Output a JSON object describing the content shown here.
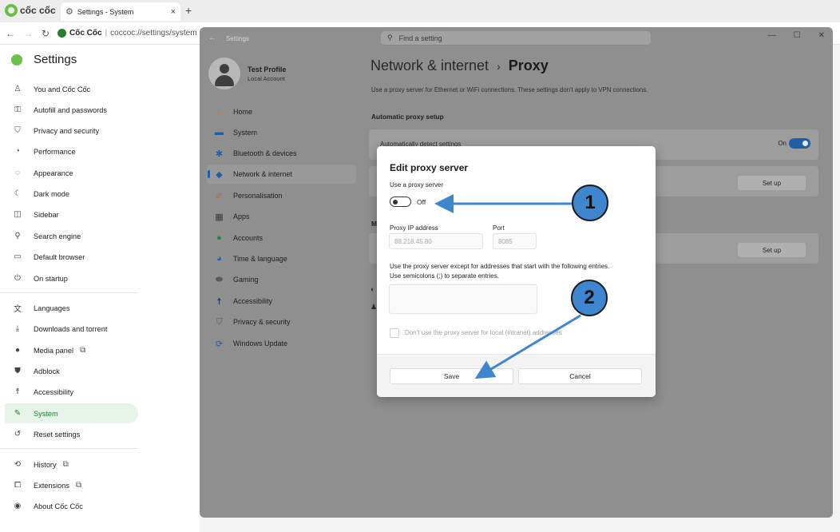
{
  "browser": {
    "brand": "cốc cốc",
    "tab_title": "Settings - System",
    "tab_close": "×",
    "new_tab": "+",
    "site_name": "Cốc Cốc",
    "url": "coccoc://settings/system"
  },
  "cc_settings": {
    "title": "Settings",
    "items": [
      {
        "label": "You and Cốc Cốc",
        "icon": "person-icon"
      },
      {
        "label": "Autofill and passwords",
        "icon": "key-icon"
      },
      {
        "label": "Privacy and security",
        "icon": "shield-icon"
      },
      {
        "label": "Performance",
        "icon": "speedometer-icon"
      },
      {
        "label": "Appearance",
        "icon": "palette-icon"
      },
      {
        "label": "Dark mode",
        "icon": "moon-icon"
      },
      {
        "label": "Sidebar",
        "icon": "sidebar-icon"
      },
      {
        "label": "Search engine",
        "icon": "search-icon"
      },
      {
        "label": "Default browser",
        "icon": "browser-icon"
      },
      {
        "label": "On startup",
        "icon": "power-icon"
      },
      {
        "label": "Languages",
        "icon": "translate-icon"
      },
      {
        "label": "Downloads and torrent",
        "icon": "download-icon"
      },
      {
        "label": "Media panel",
        "icon": "media-icon"
      },
      {
        "label": "Adblock",
        "icon": "adblock-icon"
      },
      {
        "label": "Accessibility",
        "icon": "accessibility-icon"
      },
      {
        "label": "System",
        "icon": "wrench-icon",
        "active": true
      },
      {
        "label": "Reset settings",
        "icon": "reset-icon"
      },
      {
        "label": "History",
        "icon": "history-icon"
      },
      {
        "label": "Extensions",
        "icon": "puzzle-icon"
      },
      {
        "label": "About Cốc Cốc",
        "icon": "coccoc-logo-icon"
      }
    ]
  },
  "win_settings": {
    "app_title": "Settings",
    "search_placeholder": "Find a setting",
    "profile": {
      "name": "Test Profile",
      "sub": "Local Account"
    },
    "nav": [
      {
        "label": "Home",
        "icon": "home-icon"
      },
      {
        "label": "System",
        "icon": "monitor-icon"
      },
      {
        "label": "Bluetooth & devices",
        "icon": "bluetooth-icon"
      },
      {
        "label": "Network & internet",
        "icon": "wifi-icon",
        "active": true
      },
      {
        "label": "Personalisation",
        "icon": "brush-icon"
      },
      {
        "label": "Apps",
        "icon": "apps-icon"
      },
      {
        "label": "Accounts",
        "icon": "account-icon"
      },
      {
        "label": "Time & language",
        "icon": "globe-clock-icon"
      },
      {
        "label": "Gaming",
        "icon": "gamepad-icon"
      },
      {
        "label": "Accessibility",
        "icon": "accessibility-icon"
      },
      {
        "label": "Privacy & security",
        "icon": "shield-icon"
      },
      {
        "label": "Windows Update",
        "icon": "update-icon"
      }
    ],
    "breadcrumb_parent": "Network & internet",
    "breadcrumb_sep": "›",
    "breadcrumb_current": "Proxy",
    "description": "Use a proxy server for Ethernet or WiFi connections. These settings don't apply to VPN connections.",
    "auto_section": "Automatic proxy setup",
    "auto_detect_label": "Automatically detect settings",
    "auto_detect_state": "On",
    "setup_label": "Set up",
    "manual_section_initial": "M"
  },
  "dialog": {
    "title": "Edit proxy server",
    "use_proxy_label": "Use a proxy server",
    "toggle_state": "Off",
    "ip_label": "Proxy IP address",
    "ip_value": "88.218.45.80",
    "port_label": "Port",
    "port_value": "8085",
    "exceptions_label_1": "Use the proxy server except for addresses that start with the following entries.",
    "exceptions_label_2": "Use semicolons (;) to separate entries.",
    "local_checkbox_label": "Don't use the proxy server for local (intranet) addresses",
    "save": "Save",
    "cancel": "Cancel"
  },
  "annotations": {
    "one": "1",
    "two": "2"
  },
  "colors": {
    "accent": "#1f5fa8",
    "callout": "#3f86d0",
    "coccoc_green": "#6cc04a"
  }
}
